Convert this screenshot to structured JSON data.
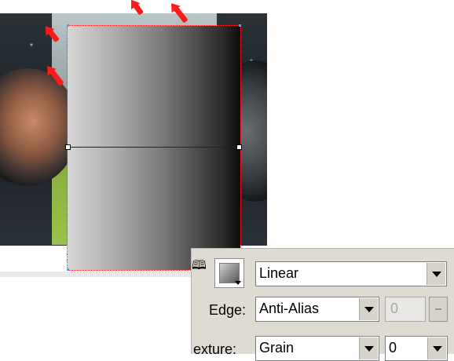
{
  "inspector": {
    "fill_type": "Linear",
    "edge_label": "Edge:",
    "edge_value": "Anti-Alias",
    "feather_value": "0",
    "texture_label": "exture:",
    "texture_value": "Grain",
    "texture_amount": "0"
  },
  "colors": {
    "selection_outline": "#ff2a2a",
    "arrow": "#ff1a1a",
    "panel_bg": "#dedbd2"
  }
}
